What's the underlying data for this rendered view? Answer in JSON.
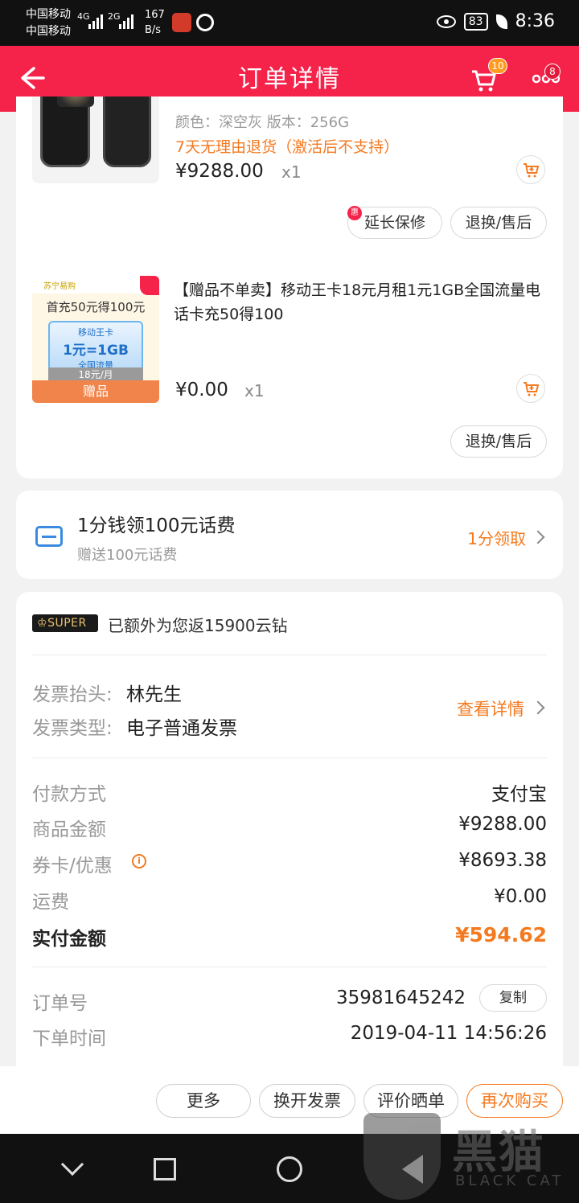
{
  "status_bar": {
    "carrier1": "中国移动",
    "carrier2": "中国移动",
    "signal1": "4G",
    "signal2": "2G",
    "speed": "167",
    "speed_unit": "B/s",
    "battery": "83",
    "time": "8:36"
  },
  "header": {
    "title": "订单详情",
    "cart_badge": "10",
    "more_badge": "8"
  },
  "product1": {
    "spec": "颜色：深空灰 版本：256G",
    "return_policy": "7天无理由退货（激活后不支持）",
    "price": "¥9288.00",
    "qty": "x1",
    "warranty_badge": "惠",
    "warranty_label": "延长保修",
    "after_sale_label": "退换/售后"
  },
  "product2": {
    "thumb_brand": "苏宁易购",
    "thumb_head": "首充50元得100元",
    "thumb_card_title": "移动王卡",
    "thumb_card_main": "1元=1GB",
    "thumb_card_sub": "全国流量",
    "thumb_month": "18元/月",
    "thumb_gift": "赠品",
    "name": "【赠品不单卖】移动王卡18元月租1元1GB全国流量电话卡充50得100",
    "price": "¥0.00",
    "qty": "x1",
    "after_sale_label": "退换/售后"
  },
  "promo": {
    "title": "1分钱领100元话费",
    "subtitle": "赠送100元话费",
    "action": "1分领取"
  },
  "super": {
    "badge": "SUPER",
    "text": "已额外为您返15900云钻"
  },
  "invoice": {
    "title_label": "发票抬头:",
    "title_value": "林先生",
    "type_label": "发票类型:",
    "type_value": "电子普通发票",
    "action": "查看详情"
  },
  "payment": {
    "rows": [
      {
        "label": "付款方式",
        "value": "支付宝"
      },
      {
        "label": "商品金额",
        "value": "¥9288.00"
      },
      {
        "label": "券卡/优惠",
        "value": "¥8693.38"
      },
      {
        "label": "运费",
        "value": "¥0.00"
      },
      {
        "label": "实付金额",
        "value": "¥594.62"
      }
    ]
  },
  "order": {
    "no_label": "订单号",
    "no_value": "35981645242",
    "copy_label": "复制",
    "time_label": "下单时间",
    "time_value": "2019-04-11 14:56:26"
  },
  "actions": {
    "more": "更多",
    "reissue_invoice": "换开发票",
    "review": "评价晒单",
    "buy_again": "再次购买"
  },
  "watermark": {
    "text": "黑猫",
    "sub": "BLACK CAT"
  },
  "colors": {
    "header_bg": "#f5224a",
    "accent_orange": "#f47a20",
    "link_blue": "#3a8be0"
  }
}
